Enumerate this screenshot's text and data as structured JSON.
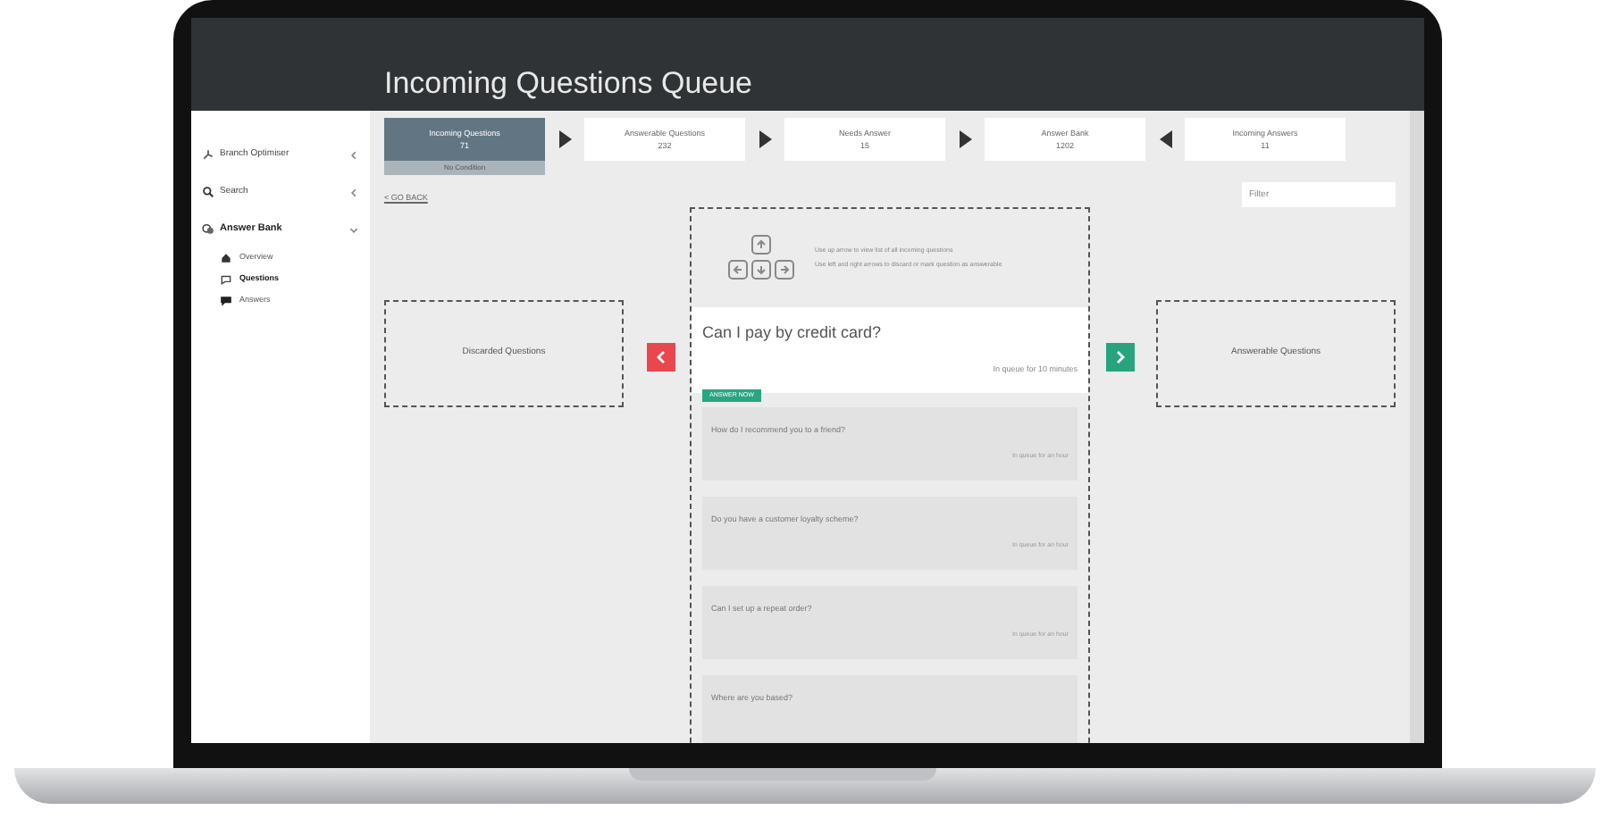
{
  "window": {
    "title": "Incoming Questions Queue"
  },
  "sidebar": {
    "items": [
      {
        "label": "Branch Optimiser",
        "expanded": false
      },
      {
        "label": "Search",
        "expanded": false
      },
      {
        "label": "Answer Bank",
        "expanded": true,
        "children": [
          {
            "label": "Overview",
            "selected": false
          },
          {
            "label": "Questions",
            "selected": true
          },
          {
            "label": "Answers",
            "selected": false
          }
        ]
      }
    ]
  },
  "stages": [
    {
      "label": "Incoming Questions",
      "count": "71",
      "selected": true,
      "sub": "No Condition"
    },
    {
      "label": "Answerable Questions",
      "count": "232",
      "selected": false
    },
    {
      "label": "Needs Answer",
      "count": "15",
      "selected": false
    },
    {
      "label": "Answer Bank",
      "count": "1202",
      "selected": false
    },
    {
      "label": "Incoming Answers",
      "count": "11",
      "selected": false
    }
  ],
  "back_link": "< GO BACK",
  "filter": {
    "placeholder": "Filter"
  },
  "keyboard_hints": [
    "Use up arrow to view list of all incoming questions",
    "Use left and right arrows to discard or mark question as answerable"
  ],
  "discard_zone": "Discarded Questions",
  "answerable_zone": "Answerable Questions",
  "current": {
    "question": "Can I pay by credit card?",
    "queued": "In queue for 10 minutes",
    "badge": "ANSWER NOW"
  },
  "queue": [
    {
      "question": "How do I recommend you to a friend?",
      "queued": "In queue for an hour"
    },
    {
      "question": "Do you have a customer loyalty scheme?",
      "queued": "In queue for an hour"
    },
    {
      "question": "Can I set up a repeat order?",
      "queued": "In queue for an hour"
    },
    {
      "question": "Where are you based?"
    }
  ]
}
